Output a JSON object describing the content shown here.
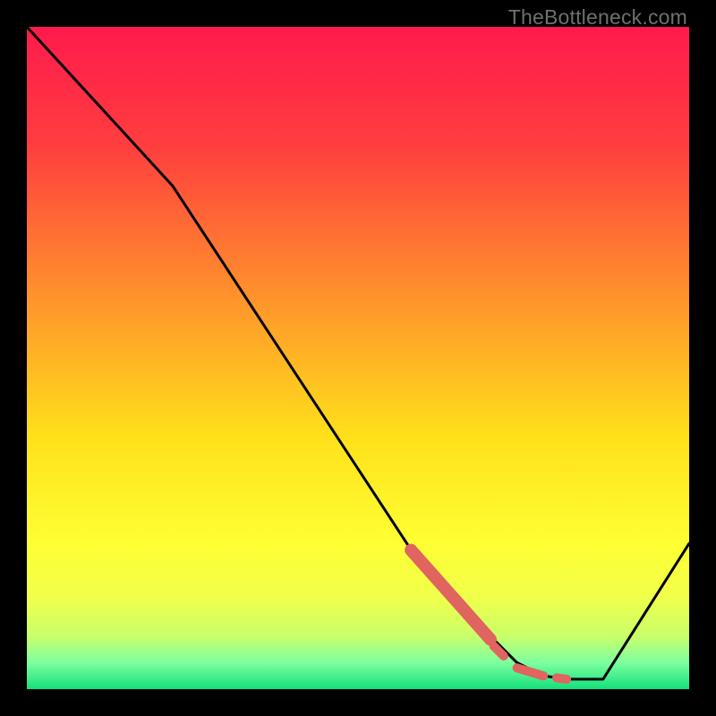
{
  "watermark": "TheBottleneck.com",
  "chart_data": {
    "type": "line",
    "title": "",
    "xlabel": "",
    "ylabel": "",
    "xlim": [
      0,
      100
    ],
    "ylim": [
      0,
      100
    ],
    "gradient_stops": [
      {
        "offset": 0,
        "color": "#ff1a4d"
      },
      {
        "offset": 18,
        "color": "#ff3e3e"
      },
      {
        "offset": 45,
        "color": "#ffa228"
      },
      {
        "offset": 62,
        "color": "#ffe11a"
      },
      {
        "offset": 78,
        "color": "#ffff33"
      },
      {
        "offset": 86,
        "color": "#f1ff4a"
      },
      {
        "offset": 92,
        "color": "#c9ff6a"
      },
      {
        "offset": 96,
        "color": "#7dffa0"
      },
      {
        "offset": 100,
        "color": "#13e07b"
      }
    ],
    "series": [
      {
        "name": "bottleneck-curve",
        "x": [
          0,
          22,
          60,
          70,
          74,
          78,
          82,
          87,
          100
        ],
        "y": [
          100,
          76,
          18,
          8,
          4,
          2,
          1.5,
          1.5,
          22
        ]
      }
    ],
    "highlight_segments": [
      {
        "name": "main-band",
        "thick": true,
        "x1": 58,
        "y1": 21,
        "x2": 70,
        "y2": 7.5
      },
      {
        "name": "dot-a",
        "thick": false,
        "x1": 70.5,
        "y1": 6.5,
        "x2": 72,
        "y2": 5
      },
      {
        "name": "dash-b",
        "thick": false,
        "x1": 74,
        "y1": 3.2,
        "x2": 78,
        "y2": 2
      },
      {
        "name": "dot-c",
        "thick": false,
        "x1": 80,
        "y1": 1.7,
        "x2": 81.5,
        "y2": 1.5
      }
    ],
    "highlight_color": "#e0645f"
  }
}
